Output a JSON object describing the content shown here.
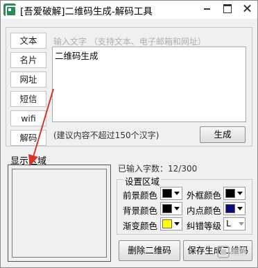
{
  "window": {
    "title": "[吾爱破解]二维码生成-解码工具",
    "accent": "#2c8a5a"
  },
  "titlebar_buttons": [
    "minimize-icon",
    "maximize-icon",
    "close-icon"
  ],
  "modes": {
    "items": [
      {
        "label": "文本"
      },
      {
        "label": "名片"
      },
      {
        "label": "网址"
      },
      {
        "label": "短信"
      },
      {
        "label": "wifi"
      },
      {
        "label": "解码"
      }
    ]
  },
  "input": {
    "hint": "输入文字 （支持文本、电子邮箱和网址）",
    "value": "二维码生成",
    "note": "(建议内容不超过150个汉字)"
  },
  "generate_label": "生成",
  "display": {
    "label": "显示区域"
  },
  "count": {
    "label": "已输入字数：12/300"
  },
  "settings": {
    "title": "设置区域",
    "foreground": {
      "label": "前景颜色",
      "color": "#000000"
    },
    "border": {
      "label": "外框颜色",
      "color": "#000000"
    },
    "background": {
      "label": "背景颜色",
      "color": "#000000"
    },
    "inner_dot": {
      "label": "内点颜色",
      "color": "#0a0a78"
    },
    "gradient": {
      "label": "渐变颜色",
      "color": "#ffff00"
    },
    "error_level": {
      "label": "纠错等级",
      "value": "L"
    }
  },
  "actions": {
    "delete_label": "删除二维码",
    "save_label": "保存生成二维码"
  },
  "annotation_color": "#d9342b"
}
